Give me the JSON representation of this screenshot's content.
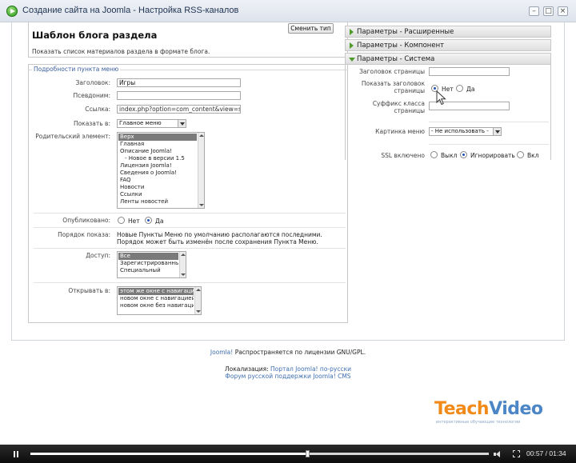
{
  "window": {
    "title": "Создание сайта на Joomla - Настройка RSS-каналов",
    "controls": {
      "minimize": "–",
      "maximize": "□",
      "close": "×"
    }
  },
  "header": {
    "title": "Шаблон блога раздела",
    "description": "Показать список материалов раздела в формате блога.",
    "change_type_label": "Сменить тип"
  },
  "details": {
    "legend": "Подробности пункта меню",
    "title_label": "Заголовок:",
    "title_value": "Игры",
    "alias_label": "Псевдоним:",
    "alias_value": "",
    "link_label": "Ссылка:",
    "link_value": "index.php?option=com_content&view=section&",
    "show_in_label": "Показать в:",
    "show_in_value": "Главное меню",
    "parent_label": "Родительский элемент:",
    "parent_items": [
      "Верх",
      "Главная",
      "Описание Joomla!",
      "- Новое в версии 1.5",
      "Лицензия Joomla!",
      "Сведения о Joomla!",
      "FAQ",
      "Новости",
      "Ссылки",
      "Ленты новостей"
    ],
    "published_label": "Опубликовано:",
    "published_no": "Нет",
    "published_yes": "Да",
    "published_value": "Да",
    "order_label": "Порядок показа:",
    "order_note": "Новые Пункты Меню по умолчанию располагаются последними. Порядок может быть изменён после сохранения Пункта Меню.",
    "access_label": "Доступ:",
    "access_items": [
      "Все",
      "Зарегистрированный",
      "Специальный"
    ],
    "open_in_label": "Открывать в:",
    "open_in_items": [
      "этом же окне с навигацией",
      "новом окне с навигацией",
      "новом окне без навигации"
    ]
  },
  "params": {
    "advanced_label": "Параметры - Расширенные",
    "component_label": "Параметры - Компонент",
    "system_label": "Параметры - Система",
    "page_title_label": "Заголовок страницы",
    "page_title_value": "",
    "show_page_title_label": "Показать заголовок страницы",
    "show_no": "Нет",
    "show_yes": "Да",
    "show_value": "Нет",
    "page_class_label": "Суффикс класса страницы",
    "page_class_value": "",
    "menu_image_label": "Картинка меню",
    "menu_image_value": "- Не использовать -",
    "ssl_label": "SSL включено",
    "ssl_off": "Выкл",
    "ssl_ignore": "Игнорировать",
    "ssl_on": "Вкл",
    "ssl_value": "Игнорировать"
  },
  "footer": {
    "joomla": "Joomla!",
    "license": "Распространяется по лицензии GNU/GPL.",
    "localization_label": "Локализация:",
    "portal_link": "Портал Joomla! по-русски",
    "forum_link": "Форум русской поддержки Joomla! CMS"
  },
  "logo": {
    "part1": "Teach",
    "part2": "Video",
    "subtitle": "интерактивные обучающие технологии"
  },
  "player": {
    "current": "00:57",
    "separator": " / ",
    "total": "01:34",
    "progress_fraction": 0.606
  }
}
